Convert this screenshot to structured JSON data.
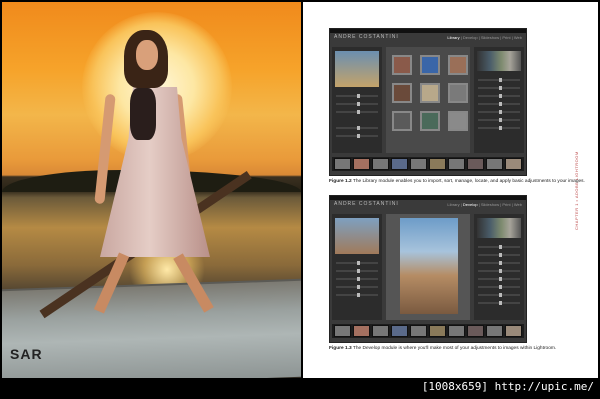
{
  "left_page": {
    "boat_lettering": "SAR"
  },
  "figure_1": {
    "brand": "ANDRE COSTANTINI",
    "modules": [
      "Library",
      "Develop",
      "Slideshow",
      "Print",
      "Web"
    ],
    "active_module": "Library",
    "caption_label": "Figure 1.2",
    "caption_text": "The Library module enables you to import, sort, manage, locate, and apply basic adjustments to your images."
  },
  "figure_2": {
    "brand": "ANDRE COSTANTINI",
    "modules": [
      "Library",
      "Develop",
      "Slideshow",
      "Print",
      "Web"
    ],
    "active_module": "Develop",
    "caption_label": "Figure 1.3",
    "caption_text": "The Develop module is where you'll make most of your adjustments to images within Lightroom."
  },
  "side_caption": "CHAPTER 1 • ADOBE LIGHTROOM",
  "footer_url": "[1008x659] http://upic.me/",
  "colors": {
    "accent": "#b44444",
    "sky": "#f6a32a"
  }
}
